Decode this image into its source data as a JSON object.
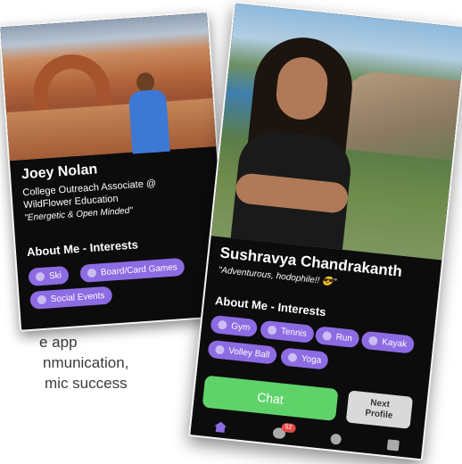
{
  "background_text": {
    "line1": "e app",
    "line2": "nmunication,",
    "line3": "mic success"
  },
  "profile_left": {
    "name": "Joey Nolan",
    "role_line1": "College Outreach Associate @",
    "role_line2": "WildFlower Education",
    "tagline": "\"Energetic & Open Minded\"",
    "about_heading": "About Me - Interests",
    "interests": [
      "Ski",
      "Board/Card Games",
      "Social Events"
    ]
  },
  "profile_right": {
    "name": "Sushravya Chandrakanth",
    "tagline": "\"Adventurous, hodophile!! 😎\"",
    "about_heading": "About Me - Interests",
    "interests": [
      "Gym",
      "Tennis",
      "Run",
      "Kayak",
      "Volley Ball",
      "Yoga"
    ],
    "chat_label": "Chat",
    "next_label_line1": "Next",
    "next_label_line2": "Profile",
    "message_badge": "52"
  },
  "colors": {
    "chip": "#8d6be3",
    "chat_button": "#5fd36a",
    "card_background": "#0c0c0c"
  },
  "icons": {
    "tab_home": "home-icon",
    "tab_messages": "chat-bubble-icon",
    "tab_profile": "person-icon",
    "tab_calendar": "calendar-icon"
  }
}
